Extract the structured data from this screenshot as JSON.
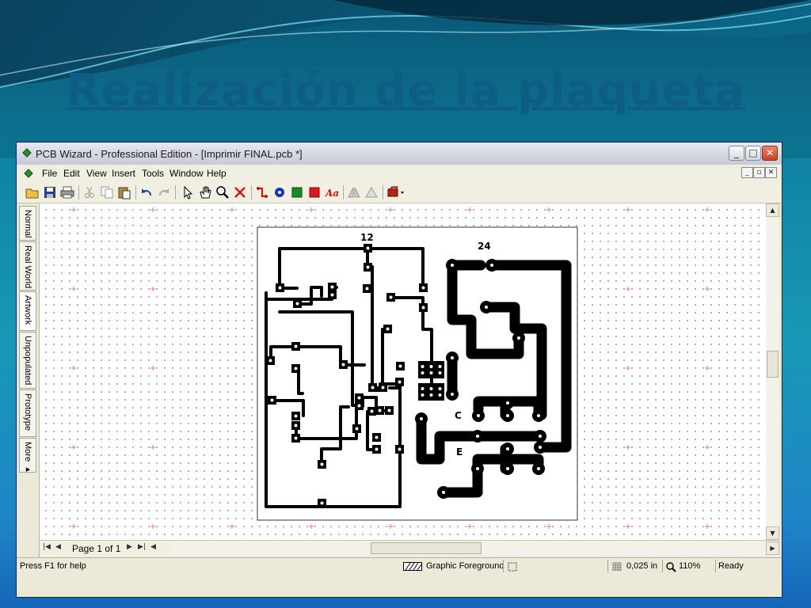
{
  "slide": {
    "title": "Realización de la plaqueta"
  },
  "window": {
    "title": "PCB Wizard - Professional Edition - [Imprimir FINAL.pcb *]"
  },
  "menu": {
    "items": [
      "File",
      "Edit",
      "View",
      "Insert",
      "Tools",
      "Window",
      "Help"
    ]
  },
  "toolbar": {
    "icons": [
      "open-icon",
      "save-icon",
      "print-icon",
      "cut-icon",
      "copy-icon",
      "paste-icon",
      "undo-icon",
      "redo-icon",
      "select-arrow-icon",
      "pan-hand-icon",
      "zoom-icon",
      "delete-icon",
      "track-icon",
      "pad-icon",
      "copper-block-icon",
      "rectangle-icon",
      "text-tool-icon",
      "mirror-icon",
      "flip-icon",
      "component-icon"
    ]
  },
  "side_tabs": [
    "Normal",
    "Real World",
    "Artwork",
    "Unpopulated",
    "Prototype",
    "More ▸"
  ],
  "active_tab": "Artwork",
  "board": {
    "labels": {
      "top_left": "12",
      "top_right": "24",
      "c": "C",
      "e": "E"
    }
  },
  "navigation": {
    "page_label": "Page 1 of 1"
  },
  "status": {
    "help": "Press F1 for help",
    "layer": "Graphic Foreground",
    "grid": "0,025 in",
    "zoom": "110%",
    "state": "Ready"
  },
  "colors": {
    "title": "#0d5d86",
    "copper": "#000000",
    "background": "#ffffff"
  }
}
